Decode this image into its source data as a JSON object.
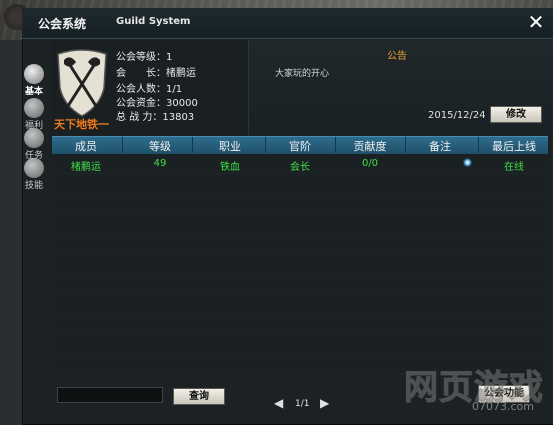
{
  "window": {
    "title_cn": "公会系统",
    "title_en": "Guild System",
    "close_label": "✕"
  },
  "side_tabs": [
    {
      "label": "基本",
      "active": true
    },
    {
      "label": "福利",
      "active": false
    },
    {
      "label": "任务",
      "active": false
    },
    {
      "label": "技能",
      "active": false
    }
  ],
  "guild": {
    "name": "天下地铁一",
    "rows": [
      {
        "label": "公会等级：",
        "value": "1"
      },
      {
        "label": "会　　长：",
        "value": "楮鹏运"
      },
      {
        "label": "公会人数：",
        "value": "1/1"
      },
      {
        "label": "公会资金：",
        "value": "30000"
      },
      {
        "label": "总 战 力：",
        "value": "13803"
      }
    ]
  },
  "announcement": {
    "title": "公告",
    "text": "大家玩的开心",
    "date": "2015/12/24",
    "edit_label": "修改"
  },
  "table": {
    "columns": [
      "成员",
      "等级",
      "职业",
      "官阶",
      "贡献度",
      "备注",
      "最后上线"
    ],
    "rows": [
      [
        "楮鹏运",
        "49",
        "铁血",
        "会长",
        "0/0",
        "",
        "在线"
      ]
    ]
  },
  "bottom": {
    "search_value": "",
    "search_label": "查询",
    "prev_arrow": "◀",
    "next_arrow": "▶",
    "page": "1/1",
    "function_label": "公会功能"
  },
  "watermark": {
    "big": "网页游戏",
    "small": "07073.com"
  },
  "colors": {
    "accent_orange": "#f07a1e",
    "online_green": "#3ee048",
    "header_blue": "#2e6d8e"
  }
}
